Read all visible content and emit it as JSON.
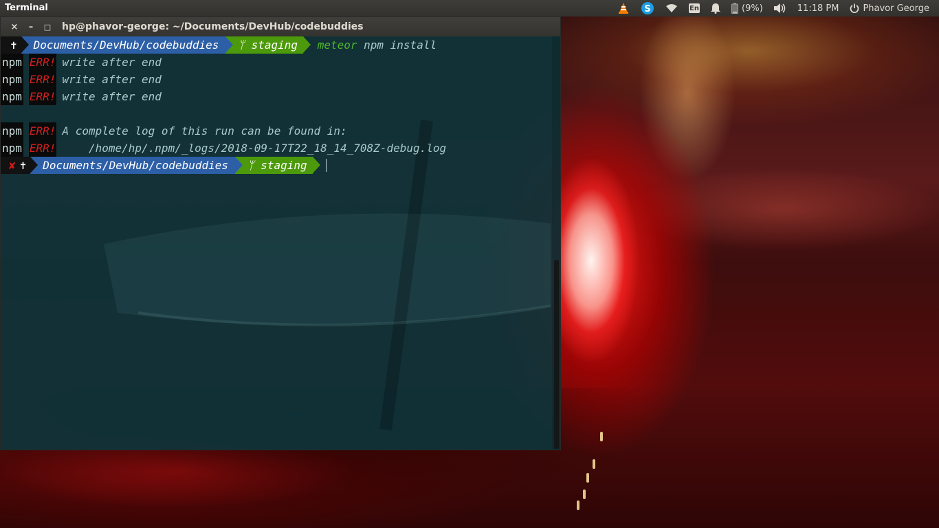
{
  "panel": {
    "app_title": "Terminal",
    "battery": "(9%)",
    "time": "11:18 PM",
    "user": "Phavor George",
    "keyboard_layout": "En",
    "icons": [
      "vlc-icon",
      "skype-icon",
      "wifi-icon",
      "keyboard-layout-icon",
      "notification-bell-icon",
      "battery-icon",
      "volume-icon",
      "power-icon"
    ],
    "colors": {
      "vlc": "#f57c00",
      "skype": "#1d9de2"
    }
  },
  "terminal": {
    "title": "hp@phavor-george: ~/Documents/DevHub/codebuddies",
    "buttons": {
      "close": "×",
      "minimize": "–",
      "maximize": "□"
    },
    "prompt": {
      "user_glyph": "✝",
      "fail_glyph": "✘",
      "dir": "Documents/DevHub/codebuddies",
      "branch_glyph": "ᛘ",
      "branch": "staging"
    },
    "command": {
      "tool": "meteor",
      "args": "npm install"
    },
    "output": [
      {
        "prefix": "npm",
        "level": "ERR!",
        "text": "write after end"
      },
      {
        "prefix": "npm",
        "level": "ERR!",
        "text": "write after end"
      },
      {
        "prefix": "npm",
        "level": "ERR!",
        "text": "write after end"
      },
      {
        "prefix": "",
        "level": "",
        "text": ""
      },
      {
        "prefix": "npm",
        "level": "ERR!",
        "text": "A complete log of this run can be found in:"
      },
      {
        "prefix": "npm",
        "level": "ERR!",
        "text": "    /home/hp/.npm/_logs/2018-09-17T22_18_14_708Z-debug.log"
      }
    ],
    "colors": {
      "dir_segment": "#2d5fa7",
      "git_segment": "#4c9a0b",
      "err_text": "#d42020",
      "command": "#4fb52a"
    }
  }
}
